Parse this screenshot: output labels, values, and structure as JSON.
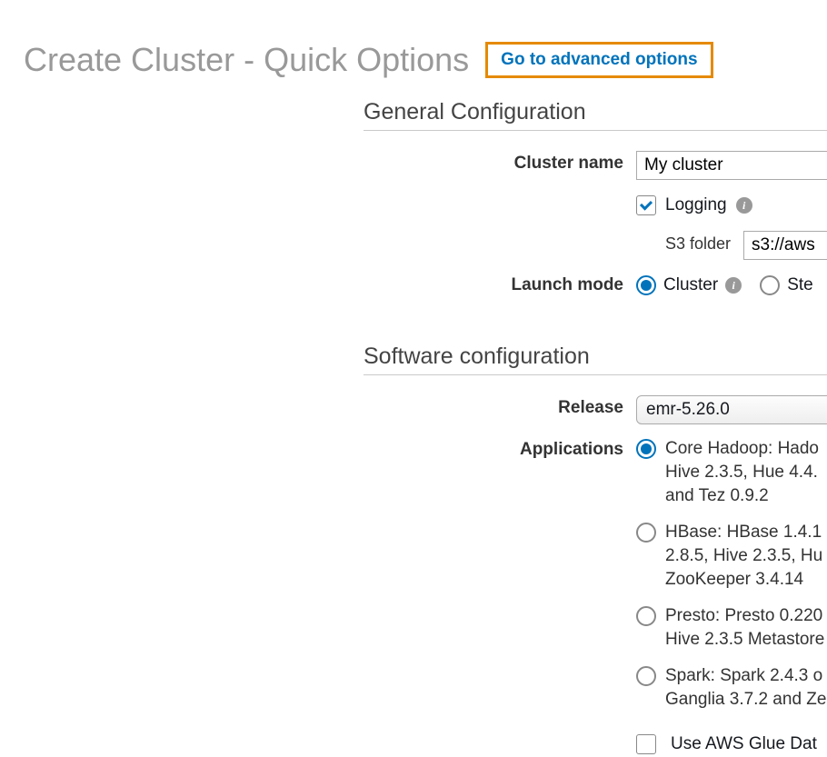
{
  "header": {
    "title": "Create Cluster - Quick Options",
    "advanced_link": "Go to advanced options"
  },
  "general": {
    "section_title": "General Configuration",
    "cluster_name_label": "Cluster name",
    "cluster_name_value": "My cluster",
    "logging_label": "Logging",
    "s3_folder_label": "S3 folder",
    "s3_folder_value": "s3://aws",
    "launch_mode_label": "Launch mode",
    "launch_cluster": "Cluster",
    "launch_step": "Ste"
  },
  "software": {
    "section_title": "Software configuration",
    "release_label": "Release",
    "release_value": "emr-5.26.0",
    "applications_label": "Applications",
    "apps": [
      "Core Hadoop: Hado Hive 2.3.5, Hue 4.4. and Tez 0.9.2",
      "HBase: HBase 1.4.1 2.8.5, Hive 2.3.5, Hu ZooKeeper 3.4.14",
      "Presto: Presto 0.220 Hive 2.3.5 Metastore",
      "Spark: Spark 2.4.3 o Ganglia 3.7.2 and Ze"
    ],
    "glue_label": "Use AWS Glue Dat"
  }
}
